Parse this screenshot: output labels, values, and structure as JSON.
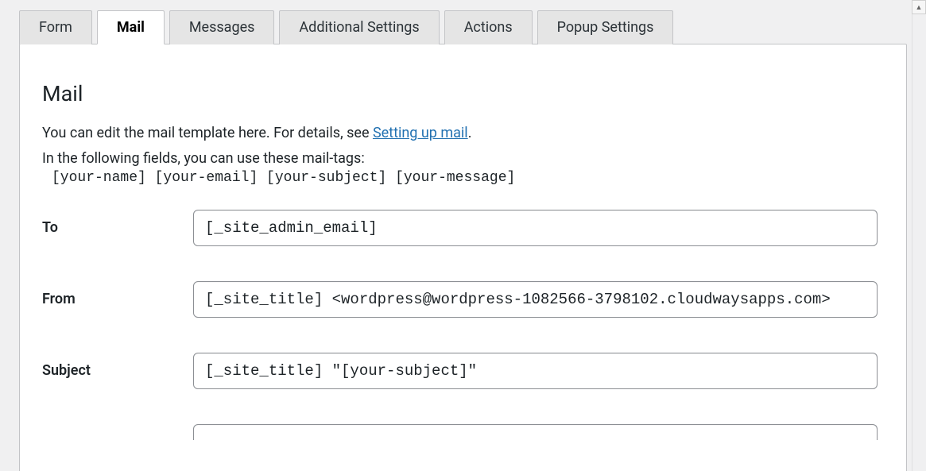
{
  "tabs": {
    "form": "Form",
    "mail": "Mail",
    "messages": "Messages",
    "additional": "Additional Settings",
    "actions": "Actions",
    "popup": "Popup Settings"
  },
  "section": {
    "title": "Mail",
    "intro_prefix": "You can edit the mail template here. For details, see ",
    "intro_link": "Setting up mail",
    "intro_suffix": ".",
    "intro2": "In the following fields, you can use these mail-tags:",
    "mail_tags": "[your-name] [your-email] [your-subject] [your-message]"
  },
  "fields": {
    "to": {
      "label": "To",
      "value": "[_site_admin_email]"
    },
    "from": {
      "label": "From",
      "value": "[_site_title] <wordpress@wordpress-1082566-3798102.cloudwaysapps.com>"
    },
    "subject": {
      "label": "Subject",
      "value": "[_site_title] \"[your-subject]\""
    }
  }
}
